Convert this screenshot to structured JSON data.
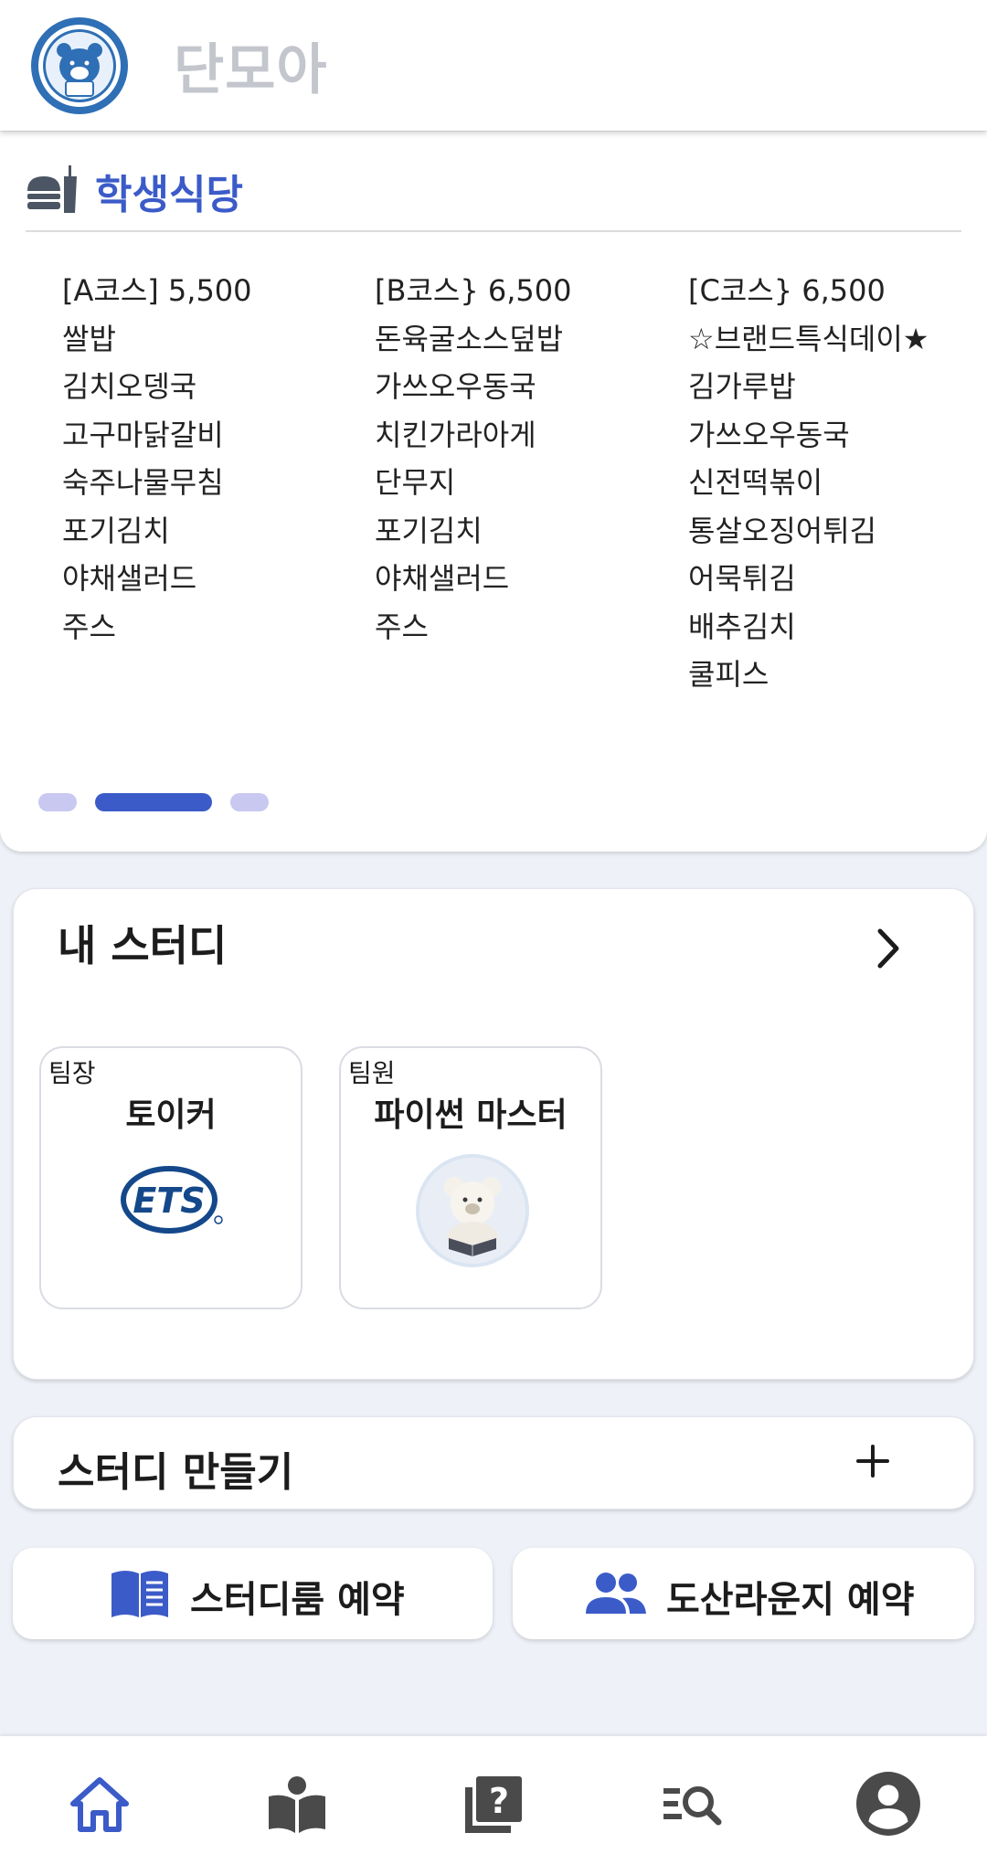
{
  "header": {
    "app_title": "단모아",
    "logo_icon": "dankook-university-bear-emblem"
  },
  "cafeteria": {
    "title": "학생식당",
    "icon": "fast-food-icon",
    "accent_color": "#3b5bc8",
    "menus": [
      {
        "items": [
          "[A코스] 5,500",
          "쌀밥",
          "김치오뎅국",
          "고구마닭갈비",
          "숙주나물무침",
          "포기김치",
          "야채샐러드",
          "주스"
        ]
      },
      {
        "items": [
          "[B코스} 6,500",
          "돈육굴소스덮밥",
          "가쓰오우동국",
          "치킨가라아게",
          "단무지",
          "포기김치",
          "야채샐러드",
          "주스"
        ]
      },
      {
        "items": [
          "[C코스} 6,500",
          "☆브랜드특식데이★",
          "김가루밥",
          "가쓰오우동국",
          "신전떡볶이",
          "통살오징어튀김",
          "어묵튀김",
          "배추김치",
          "쿨피스"
        ]
      }
    ],
    "pager": {
      "pages": 3,
      "active_index": 1
    }
  },
  "my_study": {
    "title": "내 스터디",
    "more_icon": "chevron-right-icon",
    "studies": [
      {
        "role": "팀장",
        "name": "토이커",
        "image_text": "ETS"
      },
      {
        "role": "팀원",
        "name": "파이썬 마스터",
        "image": "teddy-bear-reading-image"
      }
    ]
  },
  "create_study": {
    "label": "스터디 만들기",
    "icon": "plus-icon"
  },
  "reservations": [
    {
      "label": "스터디룸 예약",
      "icon": "book-open-icon"
    },
    {
      "label": "도산라운지 예약",
      "icon": "people-icon"
    }
  ],
  "bottom_nav": {
    "items": [
      "home-icon",
      "book-icon",
      "question-board-icon",
      "search-list-icon",
      "account-icon"
    ],
    "active": "home-icon",
    "active_color": "#3b5bc8",
    "inactive_color": "#4a4a4a"
  }
}
